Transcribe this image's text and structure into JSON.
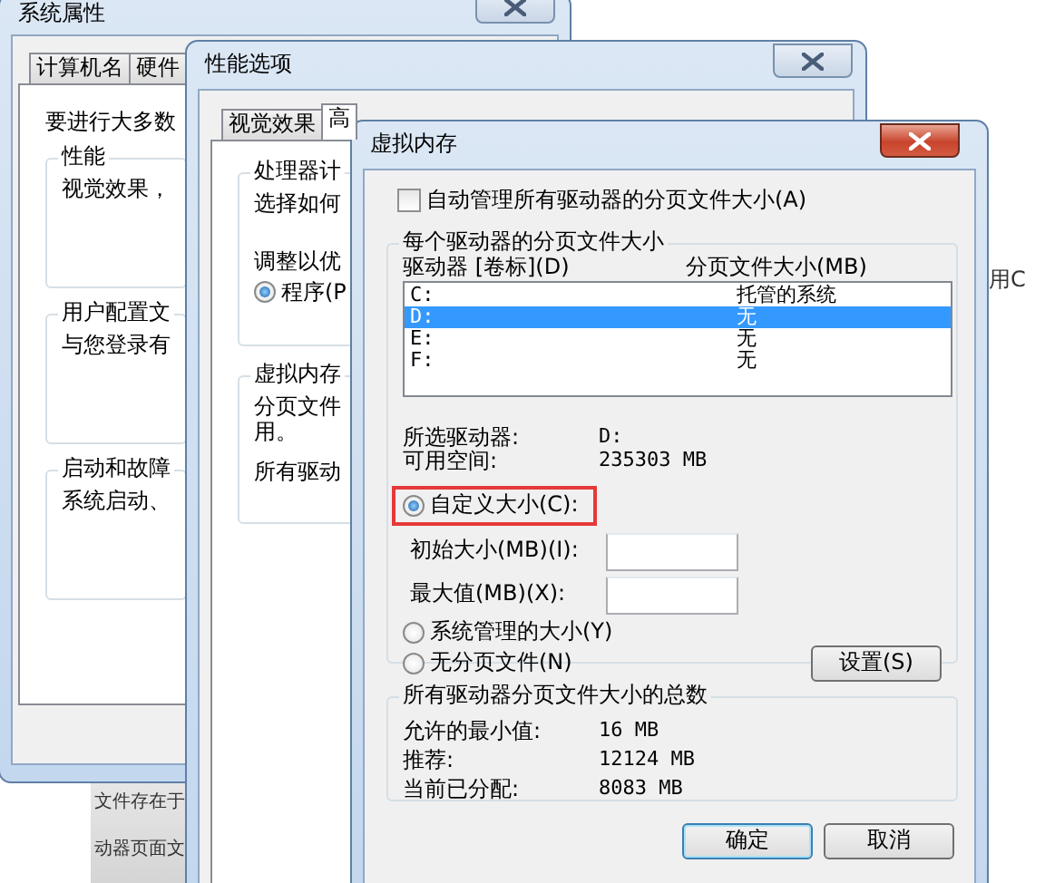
{
  "desktop": {
    "side_text": "用C",
    "fragment_lines": [
      "文件存在于",
      "动器页面文"
    ]
  },
  "system_properties": {
    "title": "系统属性",
    "tabs": [
      {
        "label": "计算机名",
        "selected": false
      },
      {
        "label": "硬件",
        "selected": false
      }
    ],
    "intro": "要进行大多数",
    "groups": [
      {
        "title": "性能",
        "text": "视觉效果，"
      },
      {
        "title": "用户配置文",
        "text": "与您登录有"
      },
      {
        "title": "启动和故障",
        "text": "系统启动、"
      }
    ]
  },
  "performance_options": {
    "title": "性能选项",
    "tabs": [
      {
        "label": "视觉效果",
        "selected": false
      },
      {
        "label": "高",
        "selected": true
      }
    ],
    "groups": [
      {
        "title": "处理器计",
        "lines": [
          "选择如何",
          "调整以优"
        ],
        "radio": {
          "label": "程序(P",
          "checked": true
        }
      },
      {
        "title": "虚拟内存",
        "lines": [
          "分页文件",
          "用。",
          "所有驱动"
        ]
      }
    ]
  },
  "virtual_memory": {
    "title": "虚拟内存",
    "auto_manage": {
      "label": "自动管理所有驱动器的分页文件大小(A)",
      "checked": false
    },
    "per_drive": {
      "title": "每个驱动器的分页文件大小",
      "columns": [
        "驱动器 [卷标](D)",
        "分页文件大小(MB)"
      ],
      "drives": [
        {
          "drive": "C:",
          "size": "托管的系统",
          "selected": false
        },
        {
          "drive": "D:",
          "size": "无",
          "selected": true
        },
        {
          "drive": "E:",
          "size": "无",
          "selected": false
        },
        {
          "drive": "F:",
          "size": "无",
          "selected": false
        }
      ],
      "info": [
        {
          "label": "所选驱动器:",
          "value": "D:"
        },
        {
          "label": "可用空间:",
          "value": "235303 MB"
        }
      ],
      "options": [
        {
          "kind": "radio",
          "label": "自定义大小(C):",
          "checked": true,
          "highlighted": true
        },
        {
          "kind": "field",
          "label": "初始大小(MB)(I):"
        },
        {
          "kind": "field",
          "label": "最大值(MB)(X):"
        },
        {
          "kind": "radio",
          "label": "系统管理的大小(Y)",
          "checked": false,
          "highlighted": false
        },
        {
          "kind": "radio",
          "label": "无分页文件(N)",
          "checked": false,
          "highlighted": false
        }
      ],
      "set_button": "设置(S)"
    },
    "totals": {
      "title": "所有驱动器分页文件大小的总数",
      "rows": [
        {
          "label": "允许的最小值:",
          "value": "16 MB"
        },
        {
          "label": "推荐:",
          "value": "12124 MB"
        },
        {
          "label": "当前已分配:",
          "value": "8083 MB"
        }
      ]
    },
    "buttons": [
      {
        "label": "确定",
        "default": true
      },
      {
        "label": "取消",
        "default": false
      }
    ]
  }
}
